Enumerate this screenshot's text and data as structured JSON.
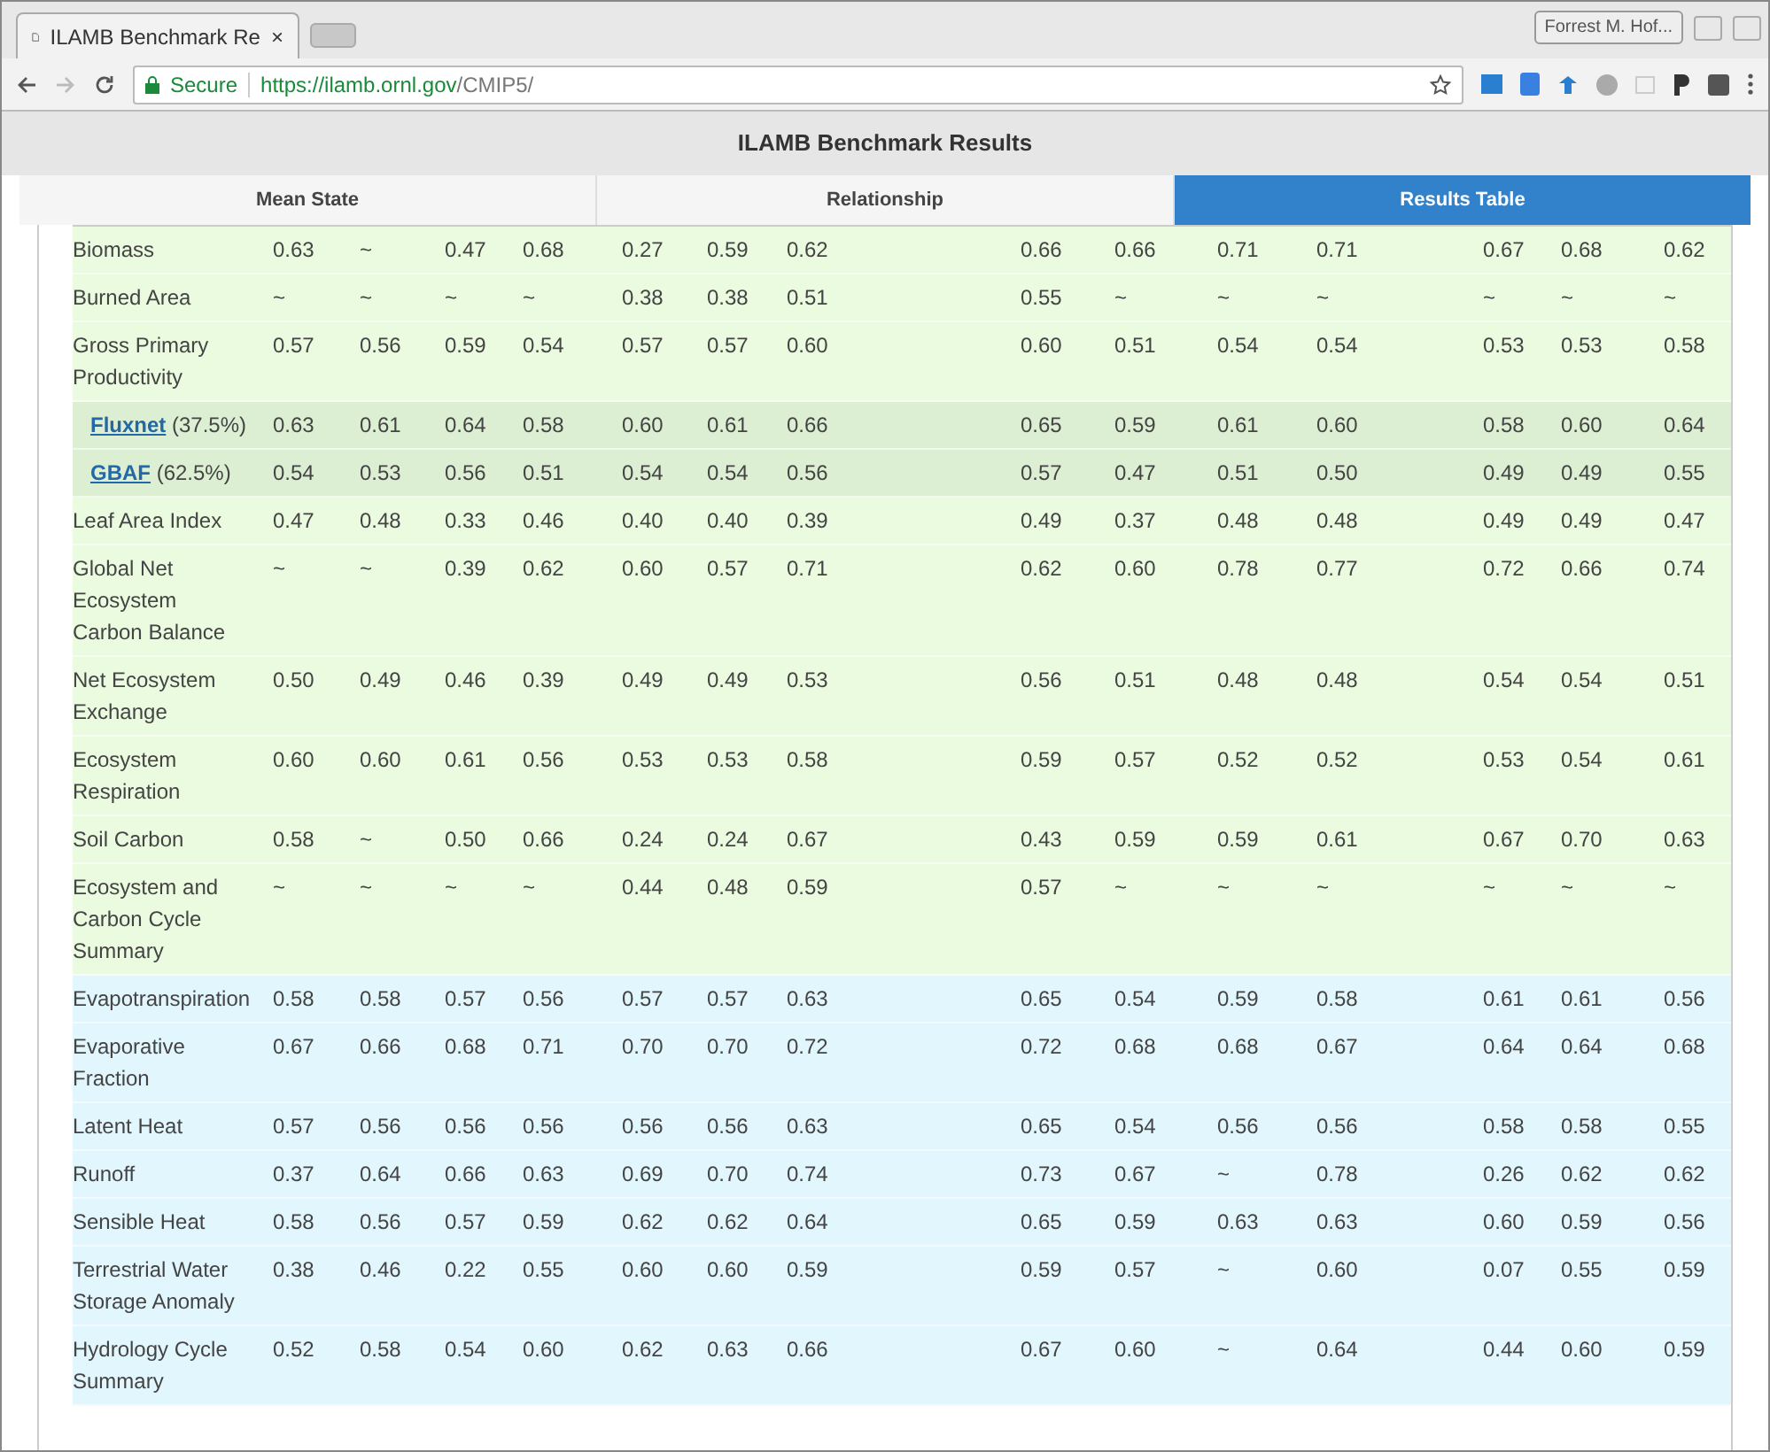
{
  "browser": {
    "tab_title": "ILAMB Benchmark Re",
    "tab_close": "×",
    "profile": "Forrest M. Hof...",
    "secure_label": "Secure",
    "url_host": "https://ilamb.ornl.gov",
    "url_path": "/CMIP5/"
  },
  "page_title": "ILAMB Benchmark Results",
  "tabs": [
    {
      "label": "Mean State",
      "selected": false
    },
    {
      "label": "Relationship",
      "selected": false
    },
    {
      "label": "Results Table",
      "selected": true
    }
  ],
  "sections": [
    {
      "color": "#ebfbe0",
      "rows": [
        {
          "name": "Biomass",
          "values": [
            "0.63",
            "~",
            "0.47",
            "0.68",
            "0.27",
            "0.59",
            "0.62",
            "0.66",
            "0.66",
            "0.71",
            "0.71",
            "0.67",
            "0.68",
            "0.62"
          ]
        },
        {
          "name": "Burned Area",
          "values": [
            "~",
            "~",
            "~",
            "~",
            "0.38",
            "0.38",
            "0.51",
            "0.55",
            "~",
            "~",
            "~",
            "~",
            "~",
            "~"
          ]
        },
        {
          "name": "Gross Primary Productivity",
          "values": [
            "0.57",
            "0.56",
            "0.59",
            "0.54",
            "0.57",
            "0.57",
            "0.60",
            "0.60",
            "0.51",
            "0.54",
            "0.54",
            "0.53",
            "0.53",
            "0.58"
          ],
          "children": [
            {
              "source": "Fluxnet",
              "weight": "(37.5%)",
              "values": [
                "0.63",
                "0.61",
                "0.64",
                "0.58",
                "0.60",
                "0.61",
                "0.66",
                "0.65",
                "0.59",
                "0.61",
                "0.60",
                "0.58",
                "0.60",
                "0.64"
              ]
            },
            {
              "source": "GBAF",
              "weight": "(62.5%)",
              "values": [
                "0.54",
                "0.53",
                "0.56",
                "0.51",
                "0.54",
                "0.54",
                "0.56",
                "0.57",
                "0.47",
                "0.51",
                "0.50",
                "0.49",
                "0.49",
                "0.55"
              ]
            }
          ]
        },
        {
          "name": "Leaf Area Index",
          "values": [
            "0.47",
            "0.48",
            "0.33",
            "0.46",
            "0.40",
            "0.40",
            "0.39",
            "0.49",
            "0.37",
            "0.48",
            "0.48",
            "0.49",
            "0.49",
            "0.47"
          ]
        },
        {
          "name": "Global Net Ecosystem Carbon Balance",
          "values": [
            "~",
            "~",
            "0.39",
            "0.62",
            "0.60",
            "0.57",
            "0.71",
            "0.62",
            "0.60",
            "0.78",
            "0.77",
            "0.72",
            "0.66",
            "0.74"
          ]
        },
        {
          "name": "Net Ecosystem Exchange",
          "values": [
            "0.50",
            "0.49",
            "0.46",
            "0.39",
            "0.49",
            "0.49",
            "0.53",
            "0.56",
            "0.51",
            "0.48",
            "0.48",
            "0.54",
            "0.54",
            "0.51"
          ]
        },
        {
          "name": "Ecosystem Respiration",
          "values": [
            "0.60",
            "0.60",
            "0.61",
            "0.56",
            "0.53",
            "0.53",
            "0.58",
            "0.59",
            "0.57",
            "0.52",
            "0.52",
            "0.53",
            "0.54",
            "0.61"
          ]
        },
        {
          "name": "Soil Carbon",
          "values": [
            "0.58",
            "~",
            "0.50",
            "0.66",
            "0.24",
            "0.24",
            "0.67",
            "0.43",
            "0.59",
            "0.59",
            "0.61",
            "0.67",
            "0.70",
            "0.63"
          ]
        },
        {
          "name": "Ecosystem and Carbon Cycle Summary",
          "values": [
            "~",
            "~",
            "~",
            "~",
            "0.44",
            "0.48",
            "0.59",
            "0.57",
            "~",
            "~",
            "~",
            "~",
            "~",
            "~"
          ]
        }
      ]
    },
    {
      "color": "#e2f6fd",
      "rows": [
        {
          "name": "Evapotranspiration",
          "values": [
            "0.58",
            "0.58",
            "0.57",
            "0.56",
            "0.57",
            "0.57",
            "0.63",
            "0.65",
            "0.54",
            "0.59",
            "0.58",
            "0.61",
            "0.61",
            "0.56"
          ]
        },
        {
          "name": "Evaporative Fraction",
          "values": [
            "0.67",
            "0.66",
            "0.68",
            "0.71",
            "0.70",
            "0.70",
            "0.72",
            "0.72",
            "0.68",
            "0.68",
            "0.67",
            "0.64",
            "0.64",
            "0.68"
          ]
        },
        {
          "name": "Latent Heat",
          "values": [
            "0.57",
            "0.56",
            "0.56",
            "0.56",
            "0.56",
            "0.56",
            "0.63",
            "0.65",
            "0.54",
            "0.56",
            "0.56",
            "0.58",
            "0.58",
            "0.55"
          ]
        },
        {
          "name": "Runoff",
          "values": [
            "0.37",
            "0.64",
            "0.66",
            "0.63",
            "0.69",
            "0.70",
            "0.74",
            "0.73",
            "0.67",
            "~",
            "0.78",
            "0.26",
            "0.62",
            "0.62"
          ]
        },
        {
          "name": "Sensible Heat",
          "values": [
            "0.58",
            "0.56",
            "0.57",
            "0.59",
            "0.62",
            "0.62",
            "0.64",
            "0.65",
            "0.59",
            "0.63",
            "0.63",
            "0.60",
            "0.59",
            "0.56"
          ]
        },
        {
          "name": "Terrestrial Water Storage Anomaly",
          "values": [
            "0.38",
            "0.46",
            "0.22",
            "0.55",
            "0.60",
            "0.60",
            "0.59",
            "0.59",
            "0.57",
            "~",
            "0.60",
            "0.07",
            "0.55",
            "0.59"
          ]
        },
        {
          "name": "Hydrology Cycle Summary",
          "values": [
            "0.52",
            "0.58",
            "0.54",
            "0.60",
            "0.62",
            "0.63",
            "0.66",
            "0.67",
            "0.60",
            "~",
            "0.64",
            "0.44",
            "0.60",
            "0.59"
          ]
        }
      ]
    }
  ]
}
